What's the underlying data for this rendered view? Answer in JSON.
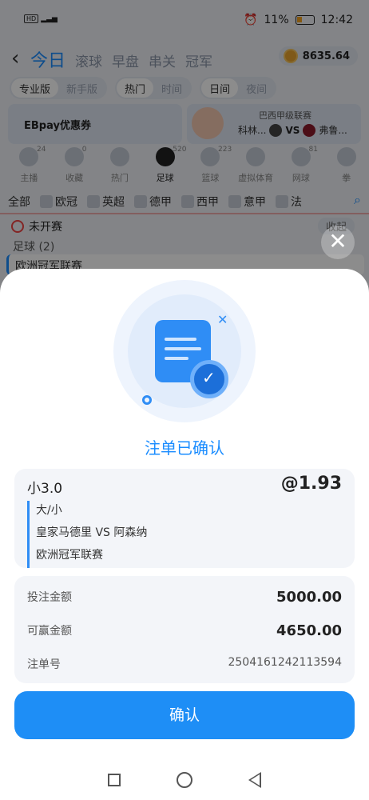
{
  "status_bar": {
    "network": "HD",
    "battery": "11%",
    "time": "12:42"
  },
  "top_nav": {
    "tabs": [
      "今日",
      "滚球",
      "早盘",
      "串关",
      "冠军"
    ],
    "balance": "8635.64"
  },
  "toggles": {
    "mode": [
      "专业版",
      "新手版"
    ],
    "sort": [
      "热门",
      "时间"
    ],
    "theme": [
      "日间",
      "夜间"
    ]
  },
  "banners": {
    "promo": "EBpay优惠券",
    "league": "巴西甲级联赛",
    "home": "科林...",
    "vs": "VS",
    "away": "弗鲁..."
  },
  "sports": [
    {
      "label": "主播",
      "count": "24"
    },
    {
      "label": "收藏",
      "count": "0"
    },
    {
      "label": "热门",
      "count": ""
    },
    {
      "label": "足球",
      "count": "520"
    },
    {
      "label": "篮球",
      "count": "223"
    },
    {
      "label": "虚拟体育",
      "count": ""
    },
    {
      "label": "网球",
      "count": "81"
    },
    {
      "label": "拳",
      "count": ""
    }
  ],
  "leagues": [
    "全部",
    "欧冠",
    "英超",
    "德甲",
    "西甲",
    "意甲",
    "法"
  ],
  "sections": {
    "upcoming": "未开赛",
    "collapse": "收起",
    "football": "足球 (2)",
    "league": "欧洲冠军联赛"
  },
  "modal": {
    "title": "注单已确认",
    "selection": "小3.0",
    "odds": "@1.93",
    "market": "大/小",
    "match": "皇家马德里 VS 阿森纳",
    "competition": "欧洲冠军联赛",
    "stake_label": "投注金额",
    "stake_value": "5000.00",
    "win_label": "可赢金额",
    "win_value": "4650.00",
    "order_label": "注单号",
    "order_value": "2504161242113594",
    "confirm": "确认"
  },
  "colors": {
    "accent": "#1a8cff",
    "overlay": "rgba(0,0,0,0.45)"
  }
}
